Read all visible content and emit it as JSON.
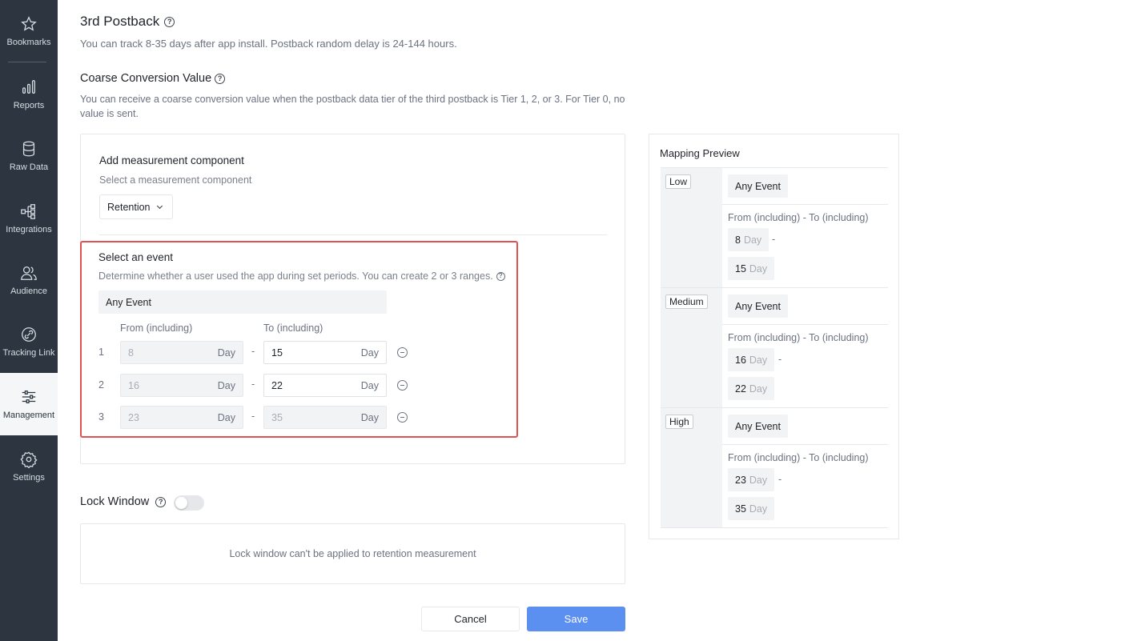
{
  "sidebar": {
    "items": [
      {
        "label": "Bookmarks",
        "icon": "star-icon"
      },
      {
        "label": "Reports",
        "icon": "bar-chart-icon"
      },
      {
        "label": "Raw Data",
        "icon": "database-icon"
      },
      {
        "label": "Integrations",
        "icon": "integrations-icon"
      },
      {
        "label": "Audience",
        "icon": "audience-icon"
      },
      {
        "label": "Tracking Link",
        "icon": "link-icon"
      },
      {
        "label": "Management",
        "icon": "sliders-icon",
        "active": true
      },
      {
        "label": "Settings",
        "icon": "gear-icon"
      }
    ]
  },
  "postback": {
    "title": "3rd Postback",
    "description": "You can track 8-35 days after app install. Postback random delay is 24-144 hours."
  },
  "coarse": {
    "title": "Coarse Conversion Value",
    "description_line1": "You can receive a coarse conversion value when the postback data tier of the third postback is Tier 1, 2, or 3. For Tier 0, no",
    "description_line2": "value is sent."
  },
  "measurement": {
    "title": "Add measurement component",
    "subtitle": "Select a measurement component",
    "selected": "Retention"
  },
  "event": {
    "title": "Select an event",
    "description": "Determine whether a user used the app during set periods. You can create 2 or 3 ranges.",
    "selected_event": "Any Event",
    "from_header": "From (including)",
    "to_header": "To (including)",
    "unit": "Day",
    "ranges": [
      {
        "index": "1",
        "from": "8",
        "to": "15"
      },
      {
        "index": "2",
        "from": "16",
        "to": "22"
      },
      {
        "index": "3",
        "from": "23",
        "to": "35"
      }
    ]
  },
  "lock_window": {
    "title": "Lock Window",
    "enabled": false,
    "message": "Lock window can't be applied to retention measurement"
  },
  "actions": {
    "cancel": "Cancel",
    "save": "Save"
  },
  "preview": {
    "title": "Mapping Preview",
    "range_label": "From (including) - To (including)",
    "unit": "Day",
    "tiers": [
      {
        "name": "Low",
        "event": "Any Event",
        "from": "8",
        "to": "15"
      },
      {
        "name": "Medium",
        "event": "Any Event",
        "from": "16",
        "to": "22"
      },
      {
        "name": "High",
        "event": "Any Event",
        "from": "23",
        "to": "35"
      }
    ]
  },
  "colors": {
    "accent": "#5b8ff0",
    "highlight": "#e05252",
    "sidebar": "#2c3540"
  }
}
